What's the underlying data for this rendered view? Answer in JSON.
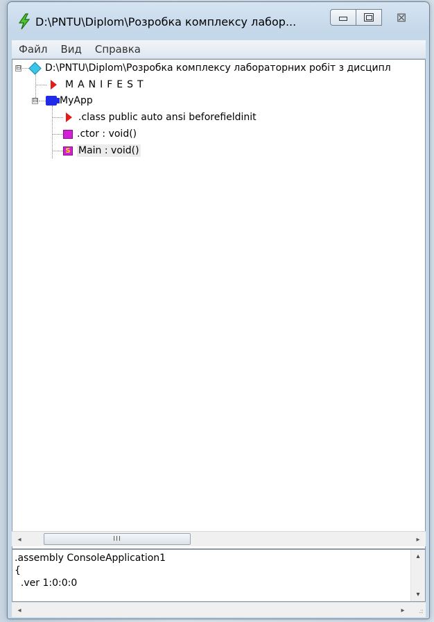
{
  "window": {
    "title": "D:\\PNTU\\Diplom\\Розробка комплексу лабор...",
    "close_glyph": "⊠"
  },
  "menu": {
    "items": [
      "Файл",
      "Вид",
      "Справка"
    ]
  },
  "tree": {
    "root": {
      "label": "D:\\PNTU\\Diplom\\Розробка комплексу лабораторних робіт з дисципл",
      "expander": "⊟",
      "icon": "assembly-diamond-icon"
    },
    "manifest": {
      "label": "MANIFEST",
      "icon": "red-triangle-icon"
    },
    "namespace": {
      "label": "MyApp",
      "expander": "⊟",
      "icon": "namespace-icon"
    },
    "members": [
      {
        "label": ".class public auto ansi beforefieldinit",
        "icon": "red-triangle-icon"
      },
      {
        "label": ".ctor : void()",
        "icon": "method-icon"
      },
      {
        "label": "Main : void()",
        "icon": "static-method-icon",
        "icon_letter": "S"
      }
    ]
  },
  "hscroll": {
    "left_arrow": "◂",
    "right_arrow": "▸",
    "thumb_grip": "III"
  },
  "il_view": {
    "lines": [
      ".assembly ConsoleApplication1",
      "{",
      "  .ver 1:0:0:0"
    ]
  },
  "vscroll": {
    "up_arrow": "▴",
    "down_arrow": "▾"
  },
  "statusbar": {
    "left_arrow": "◂",
    "right_arrow": "▸",
    "grip": ".::"
  }
}
